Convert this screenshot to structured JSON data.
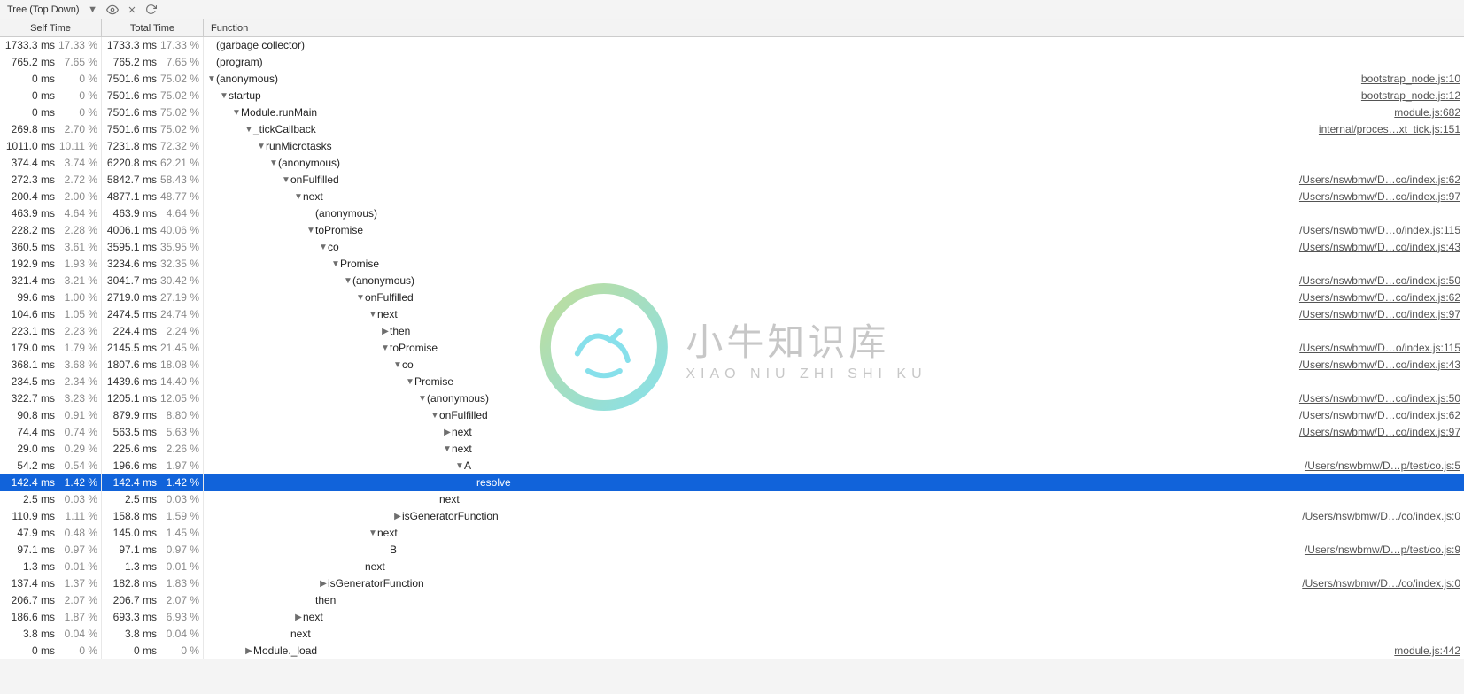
{
  "toolbar": {
    "mode_label": "Tree (Top Down)"
  },
  "columns": {
    "self": "Self Time",
    "total": "Total Time",
    "func": "Function"
  },
  "watermark": {
    "cn": "小牛知识库",
    "en": "XIAO NIU ZHI SHI KU"
  },
  "indentUnit": 14,
  "baseIndent": 4,
  "rows": [
    {
      "selfMs": "1733.3 ms",
      "selfPct": "17.33 %",
      "totalMs": "1733.3 ms",
      "totalPct": "17.33 %",
      "indent": 0,
      "arrow": "",
      "fn": "(garbage collector)",
      "src": ""
    },
    {
      "selfMs": "765.2 ms",
      "selfPct": "7.65 %",
      "totalMs": "765.2 ms",
      "totalPct": "7.65 %",
      "indent": 0,
      "arrow": "",
      "fn": "(program)",
      "src": ""
    },
    {
      "selfMs": "0 ms",
      "selfPct": "0 %",
      "totalMs": "7501.6 ms",
      "totalPct": "75.02 %",
      "indent": 0,
      "arrow": "▼",
      "fn": "(anonymous)",
      "src": "bootstrap_node.js:10"
    },
    {
      "selfMs": "0 ms",
      "selfPct": "0 %",
      "totalMs": "7501.6 ms",
      "totalPct": "75.02 %",
      "indent": 1,
      "arrow": "▼",
      "fn": "startup",
      "src": "bootstrap_node.js:12"
    },
    {
      "selfMs": "0 ms",
      "selfPct": "0 %",
      "totalMs": "7501.6 ms",
      "totalPct": "75.02 %",
      "indent": 2,
      "arrow": "▼",
      "fn": "Module.runMain",
      "src": "module.js:682"
    },
    {
      "selfMs": "269.8 ms",
      "selfPct": "2.70 %",
      "totalMs": "7501.6 ms",
      "totalPct": "75.02 %",
      "indent": 3,
      "arrow": "▼",
      "fn": "_tickCallback",
      "src": "internal/proces…xt_tick.js:151"
    },
    {
      "selfMs": "1011.0 ms",
      "selfPct": "10.11 %",
      "totalMs": "7231.8 ms",
      "totalPct": "72.32 %",
      "indent": 4,
      "arrow": "▼",
      "fn": "runMicrotasks",
      "src": ""
    },
    {
      "selfMs": "374.4 ms",
      "selfPct": "3.74 %",
      "totalMs": "6220.8 ms",
      "totalPct": "62.21 %",
      "indent": 5,
      "arrow": "▼",
      "fn": "(anonymous)",
      "src": ""
    },
    {
      "selfMs": "272.3 ms",
      "selfPct": "2.72 %",
      "totalMs": "5842.7 ms",
      "totalPct": "58.43 %",
      "indent": 6,
      "arrow": "▼",
      "fn": "onFulfilled",
      "src": "/Users/nswbmw/D…co/index.js:62"
    },
    {
      "selfMs": "200.4 ms",
      "selfPct": "2.00 %",
      "totalMs": "4877.1 ms",
      "totalPct": "48.77 %",
      "indent": 7,
      "arrow": "▼",
      "fn": "next",
      "src": "/Users/nswbmw/D…co/index.js:97"
    },
    {
      "selfMs": "463.9 ms",
      "selfPct": "4.64 %",
      "totalMs": "463.9 ms",
      "totalPct": "4.64 %",
      "indent": 8,
      "arrow": "",
      "fn": "(anonymous)",
      "src": ""
    },
    {
      "selfMs": "228.2 ms",
      "selfPct": "2.28 %",
      "totalMs": "4006.1 ms",
      "totalPct": "40.06 %",
      "indent": 8,
      "arrow": "▼",
      "fn": "toPromise",
      "src": "/Users/nswbmw/D…o/index.js:115"
    },
    {
      "selfMs": "360.5 ms",
      "selfPct": "3.61 %",
      "totalMs": "3595.1 ms",
      "totalPct": "35.95 %",
      "indent": 9,
      "arrow": "▼",
      "fn": "co",
      "src": "/Users/nswbmw/D…co/index.js:43"
    },
    {
      "selfMs": "192.9 ms",
      "selfPct": "1.93 %",
      "totalMs": "3234.6 ms",
      "totalPct": "32.35 %",
      "indent": 10,
      "arrow": "▼",
      "fn": "Promise",
      "src": ""
    },
    {
      "selfMs": "321.4 ms",
      "selfPct": "3.21 %",
      "totalMs": "3041.7 ms",
      "totalPct": "30.42 %",
      "indent": 11,
      "arrow": "▼",
      "fn": "(anonymous)",
      "src": "/Users/nswbmw/D…co/index.js:50"
    },
    {
      "selfMs": "99.6 ms",
      "selfPct": "1.00 %",
      "totalMs": "2719.0 ms",
      "totalPct": "27.19 %",
      "indent": 12,
      "arrow": "▼",
      "fn": "onFulfilled",
      "src": "/Users/nswbmw/D…co/index.js:62"
    },
    {
      "selfMs": "104.6 ms",
      "selfPct": "1.05 %",
      "totalMs": "2474.5 ms",
      "totalPct": "24.74 %",
      "indent": 13,
      "arrow": "▼",
      "fn": "next",
      "src": "/Users/nswbmw/D…co/index.js:97"
    },
    {
      "selfMs": "223.1 ms",
      "selfPct": "2.23 %",
      "totalMs": "224.4 ms",
      "totalPct": "2.24 %",
      "indent": 14,
      "arrow": "▶",
      "fn": "then",
      "src": ""
    },
    {
      "selfMs": "179.0 ms",
      "selfPct": "1.79 %",
      "totalMs": "2145.5 ms",
      "totalPct": "21.45 %",
      "indent": 14,
      "arrow": "▼",
      "fn": "toPromise",
      "src": "/Users/nswbmw/D…o/index.js:115"
    },
    {
      "selfMs": "368.1 ms",
      "selfPct": "3.68 %",
      "totalMs": "1807.6 ms",
      "totalPct": "18.08 %",
      "indent": 15,
      "arrow": "▼",
      "fn": "co",
      "src": "/Users/nswbmw/D…co/index.js:43"
    },
    {
      "selfMs": "234.5 ms",
      "selfPct": "2.34 %",
      "totalMs": "1439.6 ms",
      "totalPct": "14.40 %",
      "indent": 16,
      "arrow": "▼",
      "fn": "Promise",
      "src": ""
    },
    {
      "selfMs": "322.7 ms",
      "selfPct": "3.23 %",
      "totalMs": "1205.1 ms",
      "totalPct": "12.05 %",
      "indent": 17,
      "arrow": "▼",
      "fn": "(anonymous)",
      "src": "/Users/nswbmw/D…co/index.js:50"
    },
    {
      "selfMs": "90.8 ms",
      "selfPct": "0.91 %",
      "totalMs": "879.9 ms",
      "totalPct": "8.80 %",
      "indent": 18,
      "arrow": "▼",
      "fn": "onFulfilled",
      "src": "/Users/nswbmw/D…co/index.js:62"
    },
    {
      "selfMs": "74.4 ms",
      "selfPct": "0.74 %",
      "totalMs": "563.5 ms",
      "totalPct": "5.63 %",
      "indent": 19,
      "arrow": "▶",
      "fn": "next",
      "src": "/Users/nswbmw/D…co/index.js:97"
    },
    {
      "selfMs": "29.0 ms",
      "selfPct": "0.29 %",
      "totalMs": "225.6 ms",
      "totalPct": "2.26 %",
      "indent": 19,
      "arrow": "▼",
      "fn": "next",
      "src": ""
    },
    {
      "selfMs": "54.2 ms",
      "selfPct": "0.54 %",
      "totalMs": "196.6 ms",
      "totalPct": "1.97 %",
      "indent": 20,
      "arrow": "▼",
      "fn": "A",
      "src": "/Users/nswbmw/D…p/test/co.js:5"
    },
    {
      "selfMs": "142.4 ms",
      "selfPct": "1.42 %",
      "totalMs": "142.4 ms",
      "totalPct": "1.42 %",
      "indent": 21,
      "arrow": "",
      "fn": "resolve",
      "src": "",
      "selected": true
    },
    {
      "selfMs": "2.5 ms",
      "selfPct": "0.03 %",
      "totalMs": "2.5 ms",
      "totalPct": "0.03 %",
      "indent": 18,
      "arrow": "",
      "fn": "next",
      "src": ""
    },
    {
      "selfMs": "110.9 ms",
      "selfPct": "1.11 %",
      "totalMs": "158.8 ms",
      "totalPct": "1.59 %",
      "indent": 15,
      "arrow": "▶",
      "fn": "isGeneratorFunction",
      "src": "/Users/nswbmw/D…/co/index.js:0"
    },
    {
      "selfMs": "47.9 ms",
      "selfPct": "0.48 %",
      "totalMs": "145.0 ms",
      "totalPct": "1.45 %",
      "indent": 13,
      "arrow": "▼",
      "fn": "next",
      "src": ""
    },
    {
      "selfMs": "97.1 ms",
      "selfPct": "0.97 %",
      "totalMs": "97.1 ms",
      "totalPct": "0.97 %",
      "indent": 14,
      "arrow": "",
      "fn": "B",
      "src": "/Users/nswbmw/D…p/test/co.js:9"
    },
    {
      "selfMs": "1.3 ms",
      "selfPct": "0.01 %",
      "totalMs": "1.3 ms",
      "totalPct": "0.01 %",
      "indent": 12,
      "arrow": "",
      "fn": "next",
      "src": ""
    },
    {
      "selfMs": "137.4 ms",
      "selfPct": "1.37 %",
      "totalMs": "182.8 ms",
      "totalPct": "1.83 %",
      "indent": 9,
      "arrow": "▶",
      "fn": "isGeneratorFunction",
      "src": "/Users/nswbmw/D…/co/index.js:0"
    },
    {
      "selfMs": "206.7 ms",
      "selfPct": "2.07 %",
      "totalMs": "206.7 ms",
      "totalPct": "2.07 %",
      "indent": 8,
      "arrow": "",
      "fn": "then",
      "src": ""
    },
    {
      "selfMs": "186.6 ms",
      "selfPct": "1.87 %",
      "totalMs": "693.3 ms",
      "totalPct": "6.93 %",
      "indent": 7,
      "arrow": "▶",
      "fn": "next",
      "src": ""
    },
    {
      "selfMs": "3.8 ms",
      "selfPct": "0.04 %",
      "totalMs": "3.8 ms",
      "totalPct": "0.04 %",
      "indent": 6,
      "arrow": "",
      "fn": "next",
      "src": ""
    },
    {
      "selfMs": "0 ms",
      "selfPct": "0 %",
      "totalMs": "0 ms",
      "totalPct": "0 %",
      "indent": 3,
      "arrow": "▶",
      "fn": "Module._load",
      "src": "module.js:442"
    }
  ]
}
